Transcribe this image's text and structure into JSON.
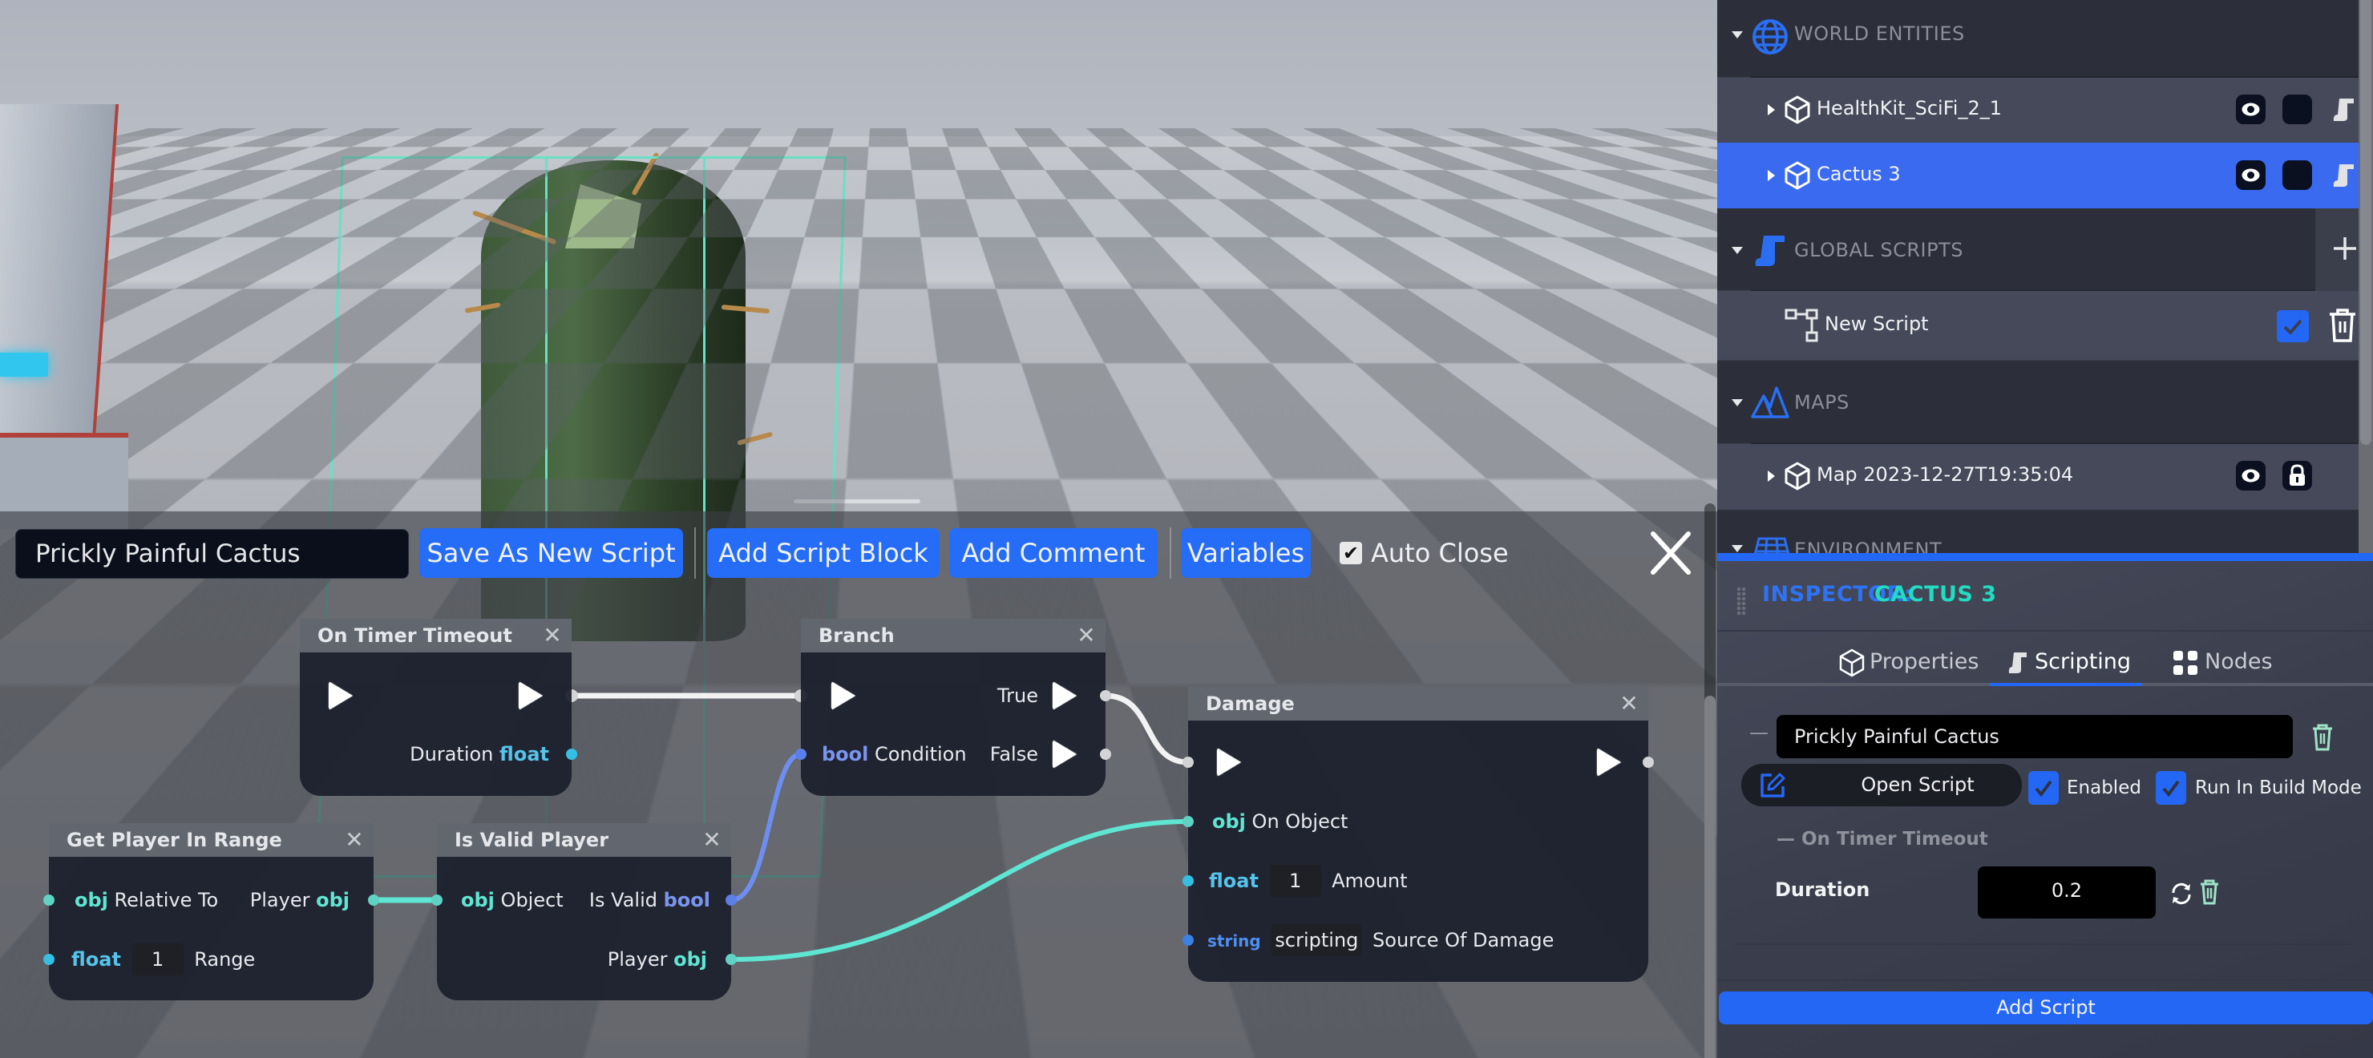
{
  "colors": {
    "accent": "#2567f5",
    "selection_row": "#3a6af0",
    "inspector_entity": "#21dcc0",
    "type_obj": "#5fe6d3",
    "type_float": "#55c3ea",
    "type_bool": "#7a95ee",
    "type_string": "#4f8ff0",
    "exec_wire": "#f2f2f2"
  },
  "editor": {
    "script_name": "Prickly Painful Cactus",
    "buttons": {
      "save_as_new": "Save As New Script",
      "add_script_block": "Add Script Block",
      "add_comment": "Add Comment",
      "variables": "Variables"
    },
    "auto_close": {
      "label": "Auto Close",
      "checked": true,
      "check_glyph": "✔"
    },
    "close_icon": "close-icon"
  },
  "nodes": {
    "on_timer_timeout": {
      "title": "On Timer Timeout",
      "close": "✕",
      "outputs": {
        "duration_label": "Duration",
        "duration_type": "float"
      }
    },
    "branch": {
      "title": "Branch",
      "close": "✕",
      "inputs": {
        "condition_type": "bool",
        "condition_label": "Condition"
      },
      "outputs": {
        "true_label": "True",
        "false_label": "False"
      }
    },
    "damage": {
      "title": "Damage",
      "close": "✕",
      "inputs": {
        "on_object_type": "obj",
        "on_object_label": "On Object",
        "amount_type": "float",
        "amount_value": "1",
        "amount_label": "Amount",
        "source_type": "string",
        "source_value": "scripting",
        "source_label": "Source Of Damage"
      }
    },
    "get_player_in_range": {
      "title": "Get Player In Range",
      "close": "✕",
      "inputs": {
        "relative_type": "obj",
        "relative_label": "Relative To",
        "range_type": "float",
        "range_value": "1",
        "range_label": "Range"
      },
      "outputs": {
        "player_label": "Player",
        "player_type": "obj"
      }
    },
    "is_valid_player": {
      "title": "Is Valid Player",
      "close": "✕",
      "inputs": {
        "object_type": "obj",
        "object_label": "Object"
      },
      "outputs": {
        "is_valid_label": "Is Valid",
        "is_valid_type": "bool",
        "player_label": "Player",
        "player_type": "obj"
      }
    }
  },
  "outliner": {
    "sections": [
      {
        "label": "WORLD ENTITIES",
        "icon": "globe-icon"
      },
      {
        "label": "GLOBAL SCRIPTS",
        "icon": "scroll-icon",
        "action": "+"
      },
      {
        "label": "MAPS",
        "icon": "mountains-icon"
      },
      {
        "label": "ENVIRONMENT",
        "icon": "solar-panel-icon"
      }
    ],
    "entities": [
      {
        "label": "HealthKit_SciFi_2_1",
        "selected": false
      },
      {
        "label": "Cactus 3",
        "selected": true
      }
    ],
    "global_scripts": [
      {
        "label": "New Script",
        "enabled": true
      }
    ],
    "maps": [
      {
        "label": "Map 2023-12-27T19:35:04"
      }
    ]
  },
  "inspector": {
    "label": "INSPECTOR:",
    "entity": "CACTUS 3",
    "tabs": [
      {
        "label": "Properties",
        "active": false
      },
      {
        "label": "Scripting",
        "active": true
      },
      {
        "label": "Nodes",
        "active": false
      }
    ],
    "script": {
      "collapse_glyph": "—",
      "name": "Prickly Painful Cactus",
      "open_label": "Open Script",
      "enabled_label": "Enabled",
      "enabled": true,
      "run_in_build_label": "Run In Build Mode",
      "run_in_build": true,
      "check_glyph": "✔",
      "event_header": "— On Timer Timeout",
      "duration_label": "Duration",
      "duration_value": "0.2"
    },
    "add_script_label": "Add Script"
  }
}
